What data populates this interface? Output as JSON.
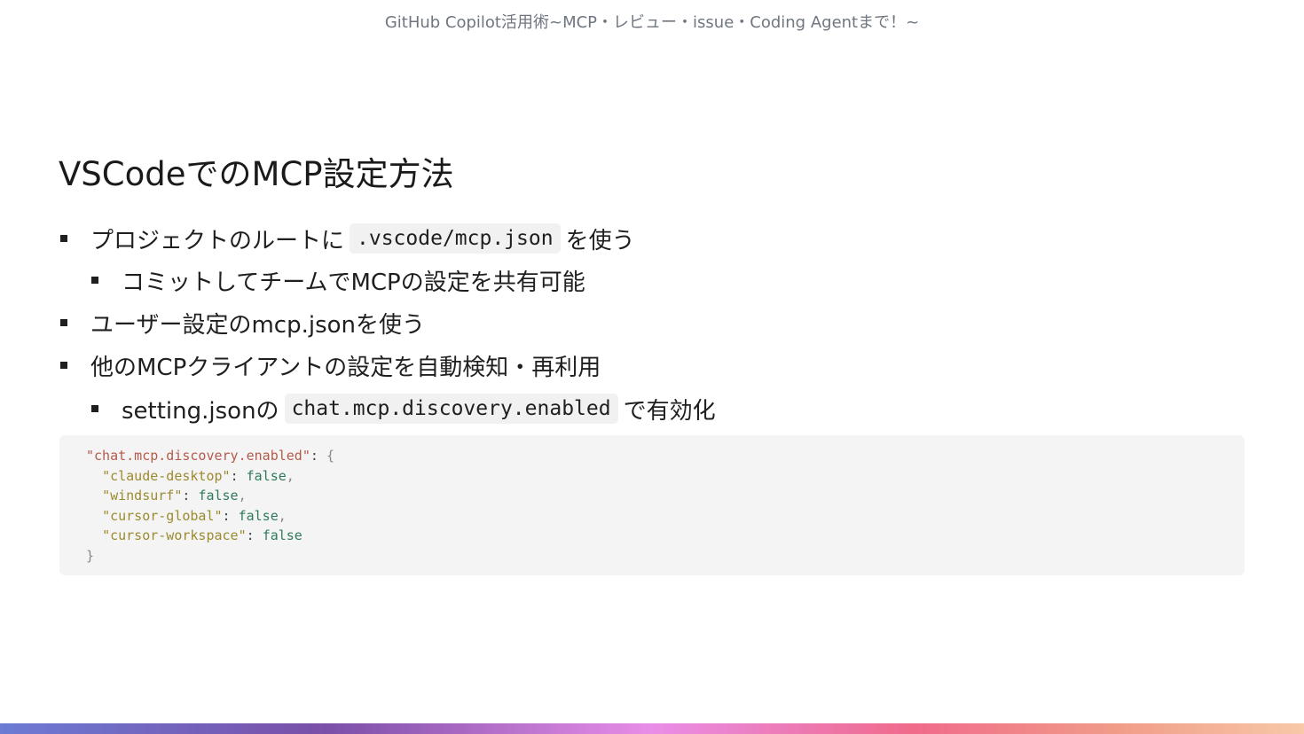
{
  "header": {
    "text": "GitHub Copilot活用術~MCP・レビュー・issue・Coding Agentまで！~"
  },
  "slide": {
    "title": "VSCodeでのMCP設定方法",
    "bullets": [
      {
        "pre": "プロジェクトのルートに",
        "code": ".vscode/mcp.json",
        "post": "を使う"
      },
      {
        "text": "コミットしてチームでMCPの設定を共有可能"
      },
      {
        "text": "ユーザー設定のmcp.jsonを使う"
      },
      {
        "text": "他のMCPクライアントの設定を自動検知・再利用"
      },
      {
        "pre": "setting.jsonの",
        "code": "chat.mcp.discovery.enabled",
        "post": "で有効化"
      }
    ]
  },
  "code_block": {
    "lines": [
      {
        "key": "\"chat.mcp.discovery.enabled\"",
        "colon": ": ",
        "value": "{"
      },
      {
        "key": "\"claude-desktop\"",
        "colon": ": ",
        "value": "false",
        "comma": ","
      },
      {
        "key": "\"windsurf\"",
        "colon": ": ",
        "value": "false",
        "comma": ","
      },
      {
        "key": "\"cursor-global\"",
        "colon": ": ",
        "value": "false",
        "comma": ","
      },
      {
        "key": "\"cursor-workspace\"",
        "colon": ": ",
        "value": "false"
      },
      {
        "close": "}"
      }
    ]
  },
  "colors": {
    "key_top": "#b35a4a",
    "key": "#9c8a2e",
    "bool": "#2f7a5a",
    "code_bg": "#f4f4f4"
  }
}
